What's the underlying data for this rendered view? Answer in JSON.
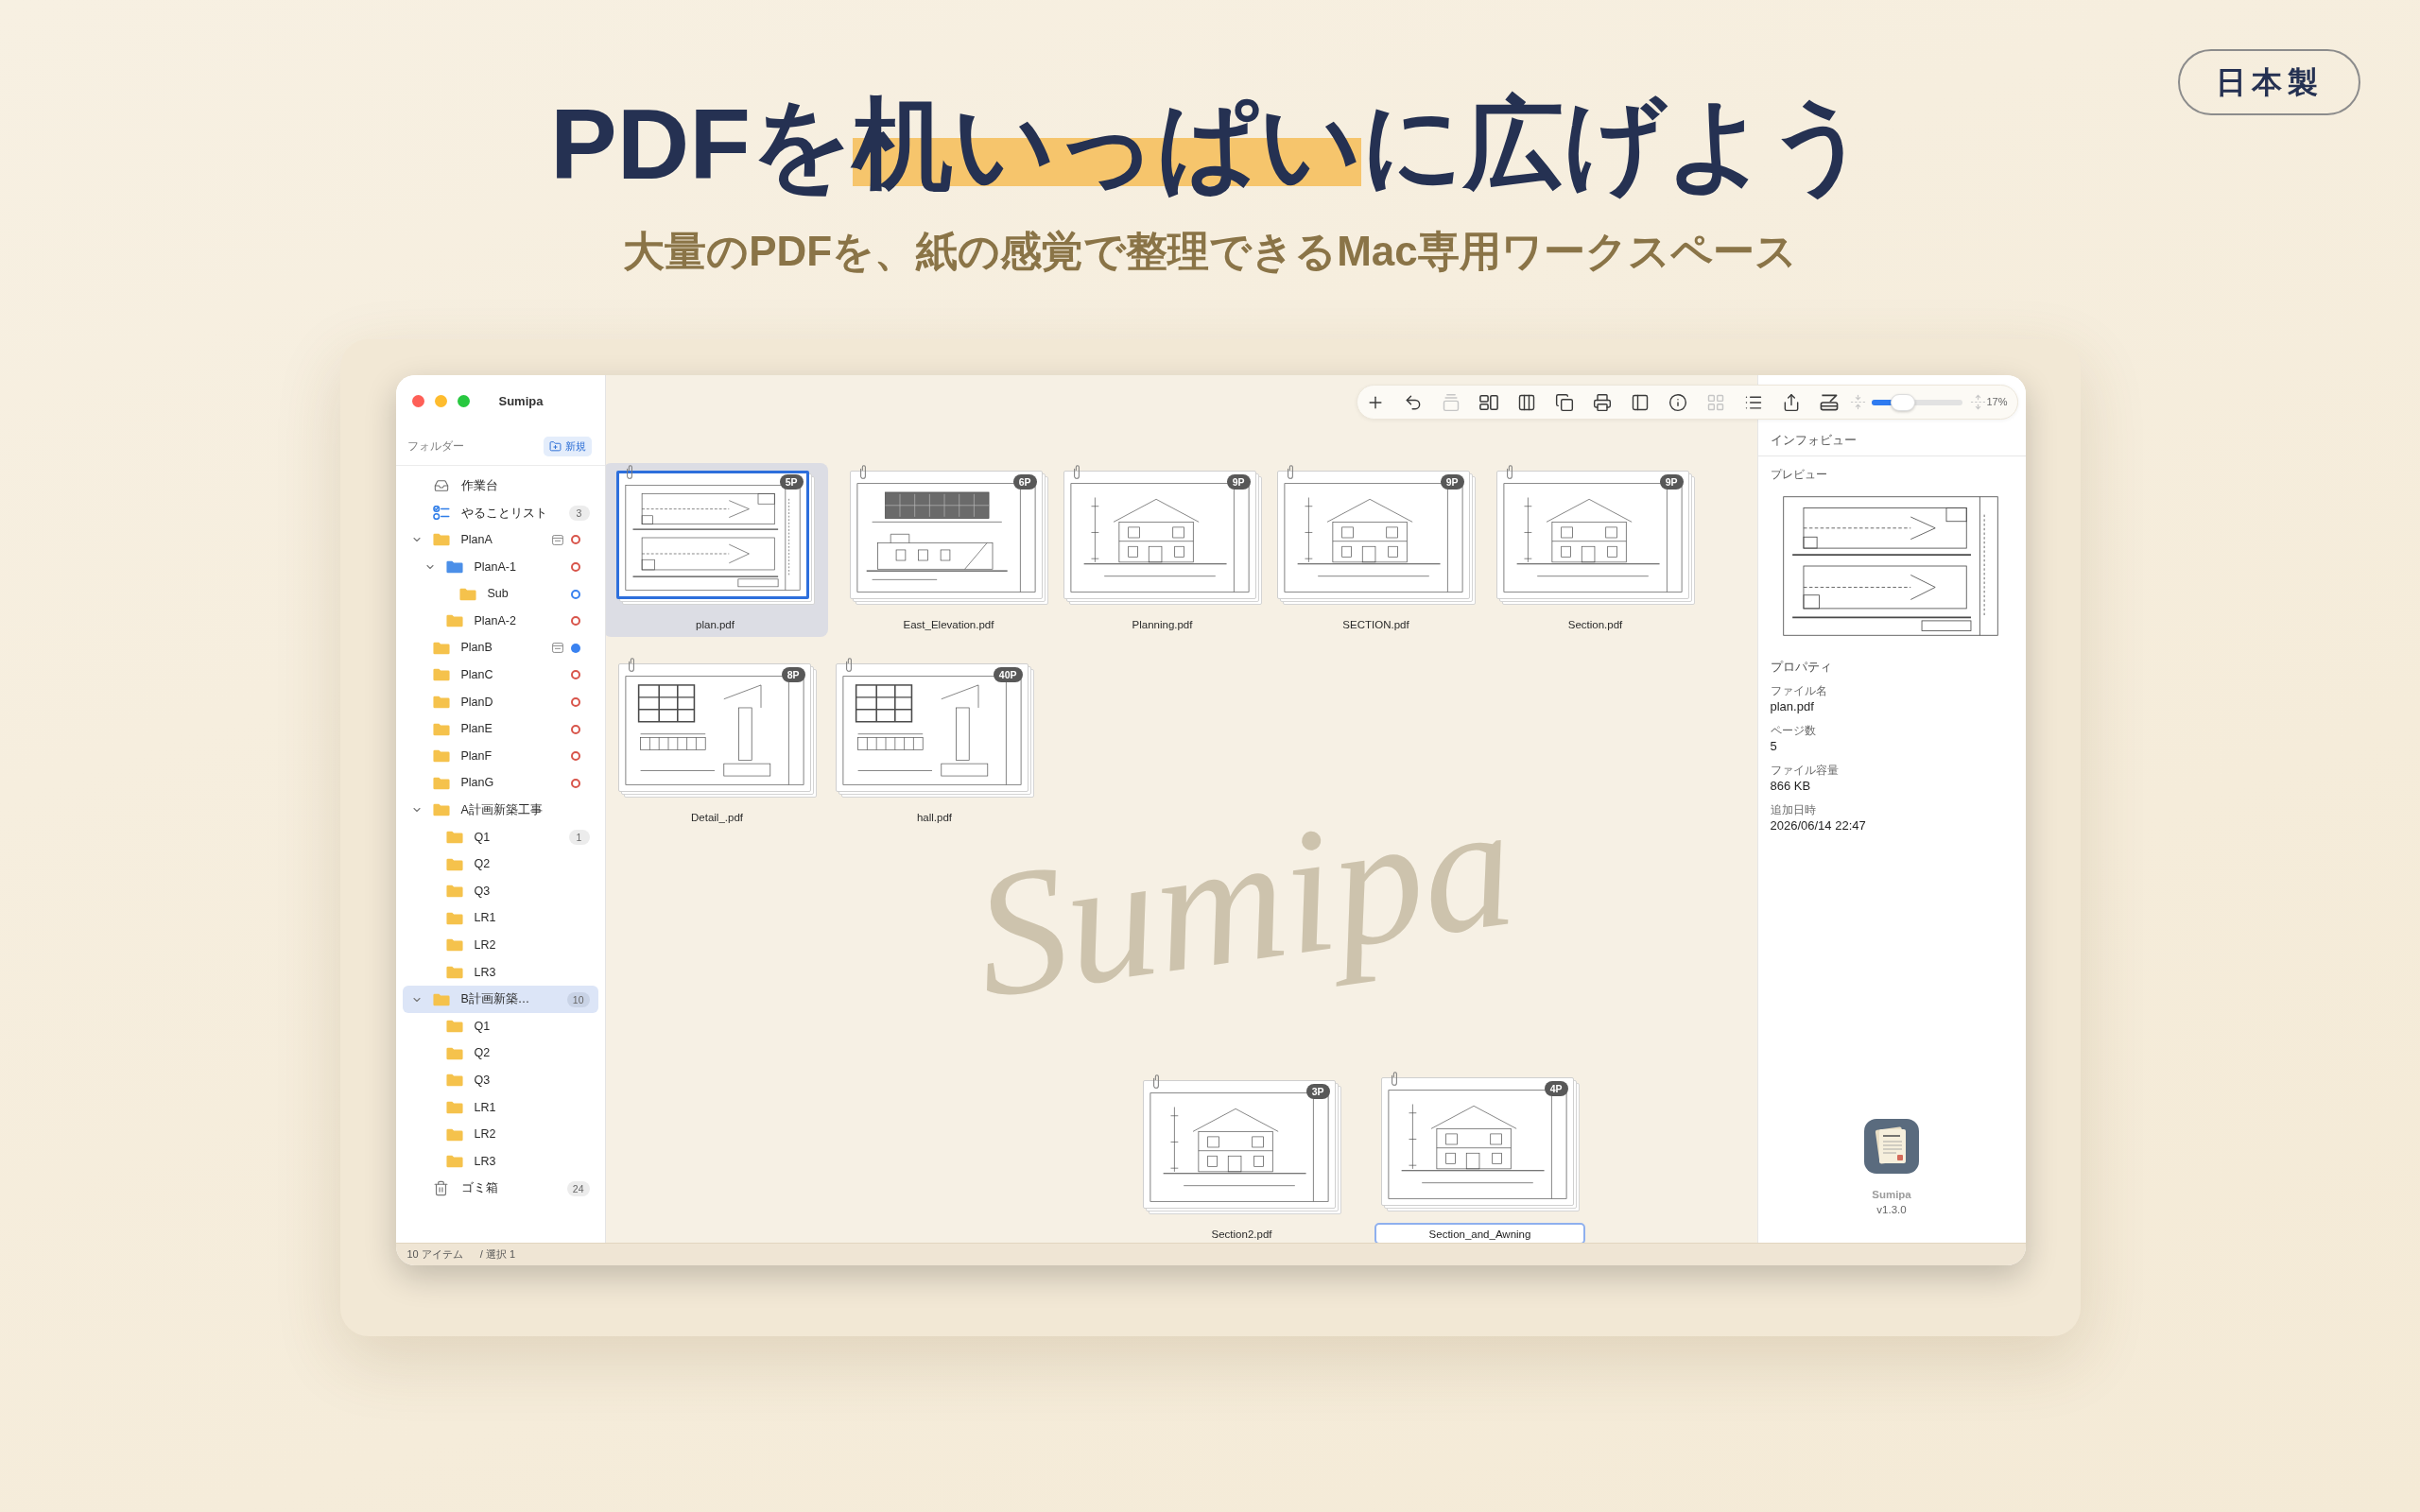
{
  "hero": {
    "headline": [
      {
        "text": "PDFを",
        "highlight": false
      },
      {
        "text": "机いっぱい",
        "highlight": true
      },
      {
        "text": "に広げよう",
        "highlight": false
      }
    ],
    "subtitle": "大量のPDFを、紙の感覚で整理できるMac専用ワークスペース",
    "badge": "日本製"
  },
  "window": {
    "title": "Sumipa"
  },
  "sidebar": {
    "heading": "フォルダー",
    "new_button": "新規",
    "items": [
      {
        "kind": "workspace",
        "label": "作業台",
        "selected": false
      },
      {
        "kind": "todo",
        "label": "やることリスト",
        "count": "3",
        "selected": false
      },
      {
        "kind": "folder",
        "label": "PlanA",
        "icon": {
          "color": "#f5c24c"
        },
        "memo": true,
        "status": {
          "kind": "ring",
          "color": "#d8554b"
        },
        "expanded": true,
        "selected": false,
        "children": [
          {
            "kind": "folder",
            "label": "PlanA-1",
            "icon": {
              "color": "#4b8fe8"
            },
            "memo": false,
            "status": {
              "kind": "ring",
              "color": "#d8554b"
            },
            "expanded": true,
            "selected": false,
            "children": [
              {
                "kind": "folder",
                "label": "Sub",
                "icon": {
                  "color": "#f5c24c"
                },
                "memo": false,
                "status": {
                  "kind": "ring",
                  "color": "#3a82f0"
                },
                "selected": false
              }
            ]
          },
          {
            "kind": "folder",
            "label": "PlanA-2",
            "icon": {
              "color": "#f5c24c"
            },
            "memo": false,
            "status": {
              "kind": "ring",
              "color": "#d8554b"
            },
            "selected": false
          }
        ]
      },
      {
        "kind": "folder",
        "label": "PlanB",
        "icon": {
          "color": "#f5c24c"
        },
        "memo": true,
        "status": {
          "kind": "dot",
          "color": "#3a82f0"
        },
        "selected": false
      },
      {
        "kind": "folder",
        "label": "PlanC",
        "icon": {
          "color": "#f5c24c"
        },
        "memo": false,
        "status": {
          "kind": "ring",
          "color": "#d8554b"
        },
        "selected": false
      },
      {
        "kind": "folder",
        "label": "PlanD",
        "icon": {
          "color": "#f5c24c"
        },
        "memo": false,
        "status": {
          "kind": "ring",
          "color": "#d8554b"
        },
        "selected": false
      },
      {
        "kind": "folder",
        "label": "PlanE",
        "icon": {
          "color": "#f5c24c"
        },
        "memo": false,
        "status": {
          "kind": "ring",
          "color": "#d8554b"
        },
        "selected": false
      },
      {
        "kind": "folder",
        "label": "PlanF",
        "icon": {
          "color": "#f5c24c"
        },
        "memo": false,
        "status": {
          "kind": "ring",
          "color": "#d8554b"
        },
        "selected": false
      },
      {
        "kind": "folder",
        "label": "PlanG",
        "icon": {
          "color": "#f5c24c"
        },
        "memo": false,
        "status": {
          "kind": "ring",
          "color": "#d8554b"
        },
        "selected": false
      },
      {
        "kind": "folder",
        "label": "A計画新築工事",
        "icon": {
          "color": "#f5c24c"
        },
        "memo": false,
        "expanded": true,
        "selected": false,
        "children": [
          {
            "kind": "folder",
            "label": "Q1",
            "icon": {
              "color": "#f5c24c"
            },
            "memo": false,
            "count": "1",
            "selected": false
          },
          {
            "kind": "folder",
            "label": "Q2",
            "icon": {
              "color": "#f5c24c"
            },
            "memo": false,
            "selected": false
          },
          {
            "kind": "folder",
            "label": "Q3",
            "icon": {
              "color": "#f5c24c"
            },
            "memo": false,
            "selected": false
          },
          {
            "kind": "folder",
            "label": "LR1",
            "icon": {
              "color": "#f5c24c"
            },
            "memo": false,
            "selected": false
          },
          {
            "kind": "folder",
            "label": "LR2",
            "icon": {
              "color": "#f5c24c"
            },
            "memo": false,
            "selected": false
          },
          {
            "kind": "folder",
            "label": "LR3",
            "icon": {
              "color": "#f5c24c"
            },
            "memo": false,
            "selected": false
          }
        ]
      },
      {
        "kind": "folder",
        "label": "B計画新築…",
        "icon": {
          "color": "#f5c24c"
        },
        "memo": false,
        "count": "10",
        "expanded": true,
        "selected": true,
        "children": [
          {
            "kind": "folder",
            "label": "Q1",
            "icon": {
              "color": "#f5c24c"
            },
            "memo": false,
            "selected": false
          },
          {
            "kind": "folder",
            "label": "Q2",
            "icon": {
              "color": "#f5c24c"
            },
            "memo": false,
            "selected": false
          },
          {
            "kind": "folder",
            "label": "Q3",
            "icon": {
              "color": "#f5c24c"
            },
            "memo": false,
            "selected": false
          },
          {
            "kind": "folder",
            "label": "LR1",
            "icon": {
              "color": "#f5c24c"
            },
            "memo": false,
            "selected": false
          },
          {
            "kind": "folder",
            "label": "LR2",
            "icon": {
              "color": "#f5c24c"
            },
            "memo": false,
            "selected": false
          },
          {
            "kind": "folder",
            "label": "LR3",
            "icon": {
              "color": "#f5c24c"
            },
            "memo": false,
            "selected": false
          }
        ]
      },
      {
        "kind": "trash",
        "label": "ゴミ箱",
        "count": "24",
        "selected": false
      }
    ]
  },
  "toolbar": {
    "buttons": [
      {
        "kind": "add",
        "disabled": false
      },
      {
        "kind": "undo",
        "disabled": false
      },
      {
        "kind": "stack",
        "disabled": true
      },
      {
        "kind": "arrange",
        "disabled": false
      },
      {
        "kind": "columns",
        "disabled": false
      },
      {
        "kind": "windows",
        "disabled": false
      },
      {
        "kind": "print",
        "disabled": false
      },
      {
        "kind": "sidebar",
        "disabled": false
      },
      {
        "kind": "info",
        "disabled": false
      },
      {
        "kind": "grid",
        "disabled": true
      },
      {
        "kind": "list",
        "disabled": false
      },
      {
        "kind": "share",
        "disabled": false
      },
      {
        "kind": "scan",
        "disabled": false
      }
    ],
    "zoom": {
      "shrink_disabled": true,
      "level": 0.35,
      "expand_disabled": true,
      "reading": "17%"
    }
  },
  "canvas": {
    "background_logo": "Sumipa",
    "files": [
      {
        "name": "plan.pdf",
        "pages": "5P",
        "selected": true,
        "editing": false
      },
      {
        "name": "East_Elevation.pdf",
        "pages": "6P",
        "selected": false,
        "editing": false
      },
      {
        "name": "Planning.pdf",
        "pages": "9P",
        "selected": false,
        "editing": false
      },
      {
        "name": "SECTION.pdf",
        "pages": "9P",
        "selected": false,
        "editing": false
      },
      {
        "name": "Section.pdf",
        "pages": "9P",
        "selected": false,
        "editing": false
      },
      {
        "name": "Detail_.pdf",
        "pages": "8P",
        "selected": false,
        "editing": false
      },
      {
        "name": "hall.pdf",
        "pages": "40P",
        "selected": false,
        "editing": false
      },
      {
        "name": "Section2.pdf",
        "pages": "3P",
        "selected": false,
        "editing": false
      },
      {
        "name": "Section_and_Awning",
        "pages": "4P",
        "selected": false,
        "editing": true
      }
    ]
  },
  "inspector": {
    "title": "インフォビュー",
    "preview_heading": "プレビュー",
    "properties_heading": "プロパティ",
    "properties": [
      {
        "label": "ファイル名",
        "value": "plan.pdf"
      },
      {
        "label": "ページ数",
        "value": "5"
      },
      {
        "label": "ファイル容量",
        "value": "866 KB"
      },
      {
        "label": "追加日時",
        "value": "2026/06/14 22:47"
      }
    ],
    "app_name": "Sumipa",
    "version": "v1.3.0"
  },
  "status_bar": {
    "item_count": "10 アイテム",
    "selection": "/ 選択 1"
  }
}
